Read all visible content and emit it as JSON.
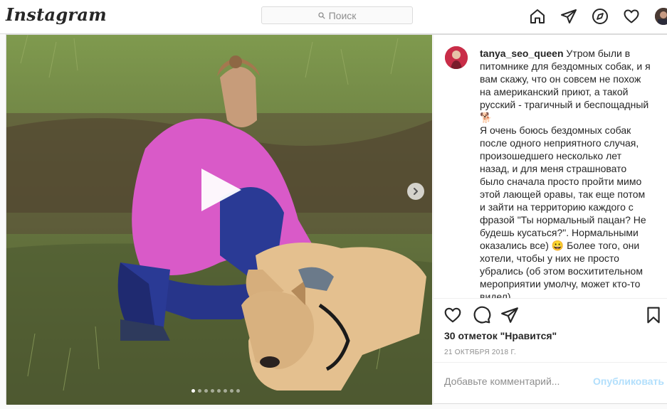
{
  "header": {
    "logo_text": "Instagram",
    "search_placeholder": "Поиск",
    "icons": [
      "home-icon",
      "direct-icon",
      "explore-icon",
      "activity-heart-icon",
      "profile-avatar"
    ]
  },
  "post": {
    "media": {
      "type": "video-carousel",
      "slide_count": 8,
      "active_slide": 1
    },
    "author": {
      "username": "tanya_seo_queen"
    },
    "caption": {
      "line_1": "Утром были в питомнике для бездомных собак, и я вам скажу, что он совсем не похож на американский приют, а такой русский - трагичный и беспощадный 🐕",
      "line_2": "Я очень боюсь бездомных собак после одного неприятного случая, произошедшего несколько лет назад, и для меня страшновато было сначала просто пройти мимо этой лающей оравы, так еще потом и зайти на территорию каждого с фразой \"Ты нормальный пацан? Не будешь кусаться?\". Нормальными оказались все) 😀 Более того, они хотели, чтобы у них не просто убрались (об этом восхитительном мероприятии умолчу, может кто-то видел)"
    },
    "likes_text": "30 отметок \"Нравится\"",
    "date_text": "21 ОКТЯБРЯ 2018 Г.",
    "comment": {
      "placeholder": "Добавьте комментарий...",
      "publish_label": "Опубликовать"
    }
  },
  "colors": {
    "border": "#dbdbdb",
    "text": "#262626",
    "muted": "#8e8e8e",
    "publish_disabled": "#b2dffc"
  }
}
